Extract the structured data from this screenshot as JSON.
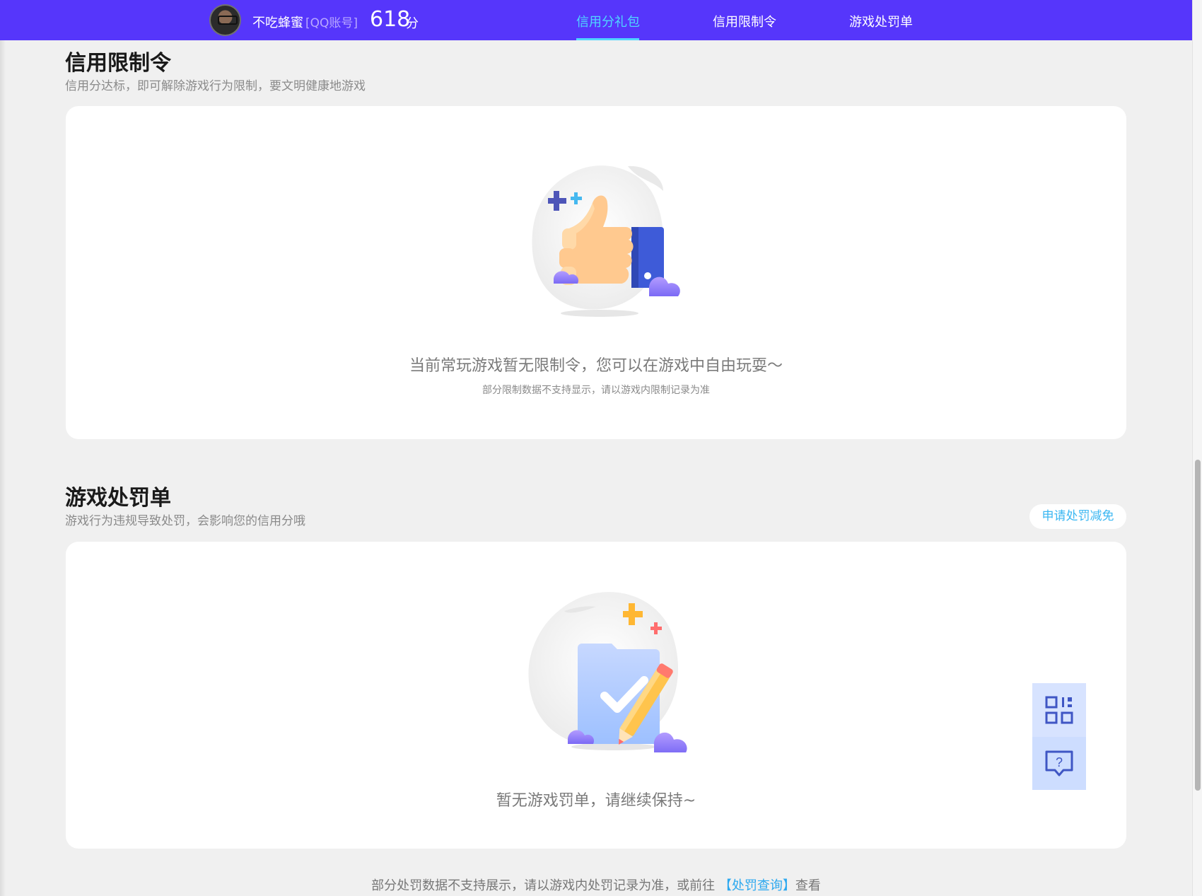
{
  "header": {
    "username": "不吃蜂蜜",
    "account_tag": "[QQ账号]",
    "score": "618",
    "score_unit": "分",
    "tabs": [
      {
        "label": "信用分礼包",
        "active": true
      },
      {
        "label": "信用限制令",
        "active": false
      },
      {
        "label": "游戏处罚单",
        "active": false
      }
    ],
    "bg_color": "#5636fb",
    "active_color": "#4fd6ff"
  },
  "restriction": {
    "title": "信用限制令",
    "subtitle": "信用分达标，即可解除游戏行为限制，要文明健康地游戏",
    "empty_message": "当前常玩游戏暂无限制令，您可以在游戏中自由玩耍～",
    "empty_note": "部分限制数据不支持显示，请以游戏内限制记录为准",
    "illustration_icon": "thumbs-up-icon"
  },
  "penalty": {
    "title": "游戏处罚单",
    "subtitle": "游戏行为违规导致处罚，会影响您的信用分哦",
    "reduce_button": "申请处罚减免",
    "empty_message": "暂无游戏罚单，请继续保持~",
    "illustration_icon": "checklist-pencil-icon"
  },
  "footer": {
    "note_before": "部分处罚数据不支持展示，请以游戏内处罚记录为准，或前往 ",
    "link": "【处罚查询】",
    "note_after": "查看"
  },
  "side_tools": [
    {
      "icon": "qr-code-icon"
    },
    {
      "icon": "help-chat-icon"
    }
  ]
}
